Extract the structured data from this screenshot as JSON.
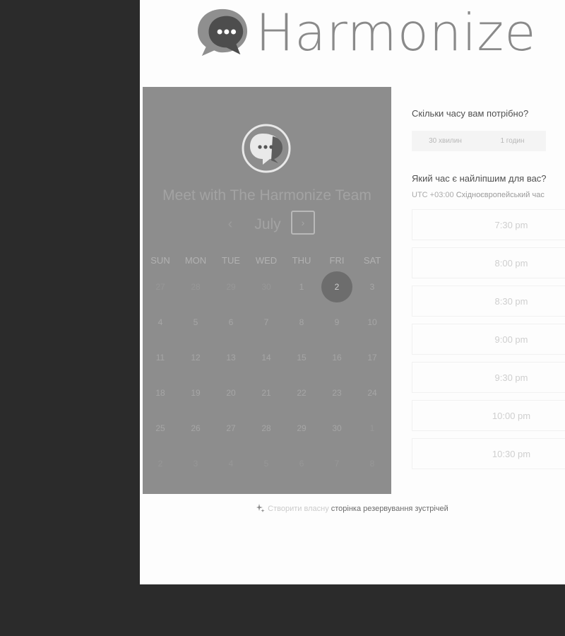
{
  "brand": {
    "name": "Harmonize"
  },
  "host": {
    "title": "Meet with The Harmonize Team"
  },
  "calendar": {
    "month": "July",
    "prev_glyph": "‹",
    "next_glyph": "›",
    "weekdays": [
      "SUN",
      "MON",
      "TUE",
      "WED",
      "THU",
      "FRI",
      "SAT"
    ],
    "weeks": [
      [
        {
          "d": "27",
          "out": true
        },
        {
          "d": "28",
          "out": true
        },
        {
          "d": "29",
          "out": true
        },
        {
          "d": "30",
          "out": true
        },
        {
          "d": "1",
          "out": false
        },
        {
          "d": "2",
          "out": false,
          "selected": true
        },
        {
          "d": "3",
          "out": false
        }
      ],
      [
        {
          "d": "4",
          "out": false
        },
        {
          "d": "5",
          "out": false
        },
        {
          "d": "6",
          "out": false
        },
        {
          "d": "7",
          "out": false
        },
        {
          "d": "8",
          "out": false
        },
        {
          "d": "9",
          "out": false
        },
        {
          "d": "10",
          "out": false
        }
      ],
      [
        {
          "d": "11",
          "out": false
        },
        {
          "d": "12",
          "out": false
        },
        {
          "d": "13",
          "out": false
        },
        {
          "d": "14",
          "out": false
        },
        {
          "d": "15",
          "out": false
        },
        {
          "d": "16",
          "out": false
        },
        {
          "d": "17",
          "out": false
        }
      ],
      [
        {
          "d": "18",
          "out": false
        },
        {
          "d": "19",
          "out": false
        },
        {
          "d": "20",
          "out": false
        },
        {
          "d": "21",
          "out": false
        },
        {
          "d": "22",
          "out": false
        },
        {
          "d": "23",
          "out": false
        },
        {
          "d": "24",
          "out": false
        }
      ],
      [
        {
          "d": "25",
          "out": false
        },
        {
          "d": "26",
          "out": false
        },
        {
          "d": "27",
          "out": false
        },
        {
          "d": "28",
          "out": false
        },
        {
          "d": "29",
          "out": false
        },
        {
          "d": "30",
          "out": false
        },
        {
          "d": "1",
          "out": true
        }
      ],
      [
        {
          "d": "2",
          "out": true
        },
        {
          "d": "3",
          "out": true
        },
        {
          "d": "4",
          "out": true
        },
        {
          "d": "5",
          "out": true
        },
        {
          "d": "6",
          "out": true
        },
        {
          "d": "7",
          "out": true
        },
        {
          "d": "8",
          "out": true
        }
      ]
    ]
  },
  "booking": {
    "duration_question": "Скільки часу вам потрібно?",
    "durations": [
      "30 хвилин",
      "1 годин"
    ],
    "time_question": "Який час є найліпшим для вас?",
    "timezone_offset": "UTC +03:00",
    "timezone_name": "Східноєвропейський час",
    "slots": [
      "7:30 pm",
      "8:00 pm",
      "8:30 pm",
      "9:00 pm",
      "9:30 pm",
      "10:00 pm",
      "10:30 pm"
    ]
  },
  "footer": {
    "lead": "Створити власну",
    "link": "сторінка резервування зустрічей"
  },
  "colors": {
    "page_bg": "#fdfdfd",
    "outer_bg": "#2b2b2b",
    "panel_bg": "#8d8d8d",
    "selected_day": "#6d6d6d"
  },
  "icons": [
    "chat-bubble-logo-icon",
    "chevron-left-icon",
    "chevron-right-icon",
    "sparkles-icon"
  ]
}
